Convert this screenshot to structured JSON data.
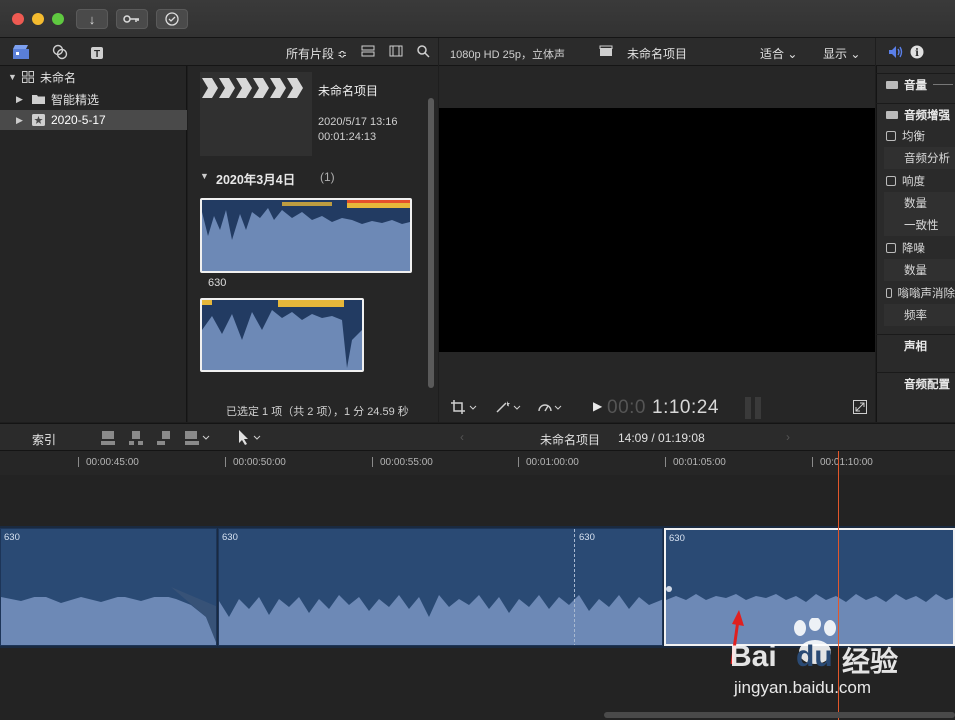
{
  "window": {
    "traffic_lights": [
      "#ee5a52",
      "#f4bb2f",
      "#5fc940"
    ],
    "toolbar_buttons": [
      "download-icon",
      "key-icon",
      "checkmark-circle-icon"
    ]
  },
  "browser_toolbar": {
    "filter_label": "所有片段 ≎",
    "tabs": [
      "libraries-icon",
      "photos-icon",
      "titles-icon"
    ]
  },
  "viewer_toolbar": {
    "format": "1080p HD 25p，立体声",
    "project_name": "未命名项目",
    "zoom_label": "适合 ⌄",
    "display_label": "显示 ⌄"
  },
  "library": {
    "root": "未命名",
    "items": [
      {
        "label": "智能精选",
        "selected": false
      },
      {
        "label": "2020-5-17",
        "selected": true
      }
    ]
  },
  "browser": {
    "project": {
      "name": "未命名项目",
      "date": "2020/5/17 13:16",
      "duration": "00:01:24:13"
    },
    "group_title": "2020年3月4日",
    "group_count": "(1)",
    "clips": [
      {
        "name": "630"
      },
      {
        "name": ""
      }
    ],
    "status": "已选定 1 项（共 2 项），1 分 24.59 秒"
  },
  "viewer": {
    "timecode_dim": "00:0",
    "timecode": "1:10:24"
  },
  "inspector": {
    "items": [
      {
        "label": "音量",
        "type": "header"
      },
      {
        "label": "音频增强",
        "type": "header"
      },
      {
        "label": "均衡",
        "type": "checkbox"
      },
      {
        "label": "音频分析",
        "type": "sub"
      },
      {
        "label": "响度",
        "type": "checkbox"
      },
      {
        "label": "数量",
        "type": "sub"
      },
      {
        "label": "一致性",
        "type": "sub"
      },
      {
        "label": "降噪",
        "type": "checkbox"
      },
      {
        "label": "数量",
        "type": "sub"
      },
      {
        "label": "嗡嗡声消除",
        "type": "checkbox"
      },
      {
        "label": "频率",
        "type": "sub"
      },
      {
        "label": "声相",
        "type": "header"
      },
      {
        "label": "音频配置",
        "type": "footer"
      }
    ]
  },
  "timeline": {
    "index_label": "索引",
    "project_name": "未命名项目",
    "position": "14:09 / 01:19:08",
    "ruler": [
      "00:00:45:00",
      "00:00:50:00",
      "00:00:55:00",
      "00:01:00:00",
      "00:01:05:00",
      "00:01:10:00"
    ],
    "clips": [
      "630",
      "630",
      "630",
      "630"
    ]
  },
  "watermark": {
    "brand": "Bai",
    "brand2": "du",
    "jingyan": "经验",
    "url": "jingyan.baidu.com"
  },
  "colors": {
    "accent_blue": "#4a6fb0",
    "playhead": "#e2572b",
    "arrow": "#e02020"
  }
}
